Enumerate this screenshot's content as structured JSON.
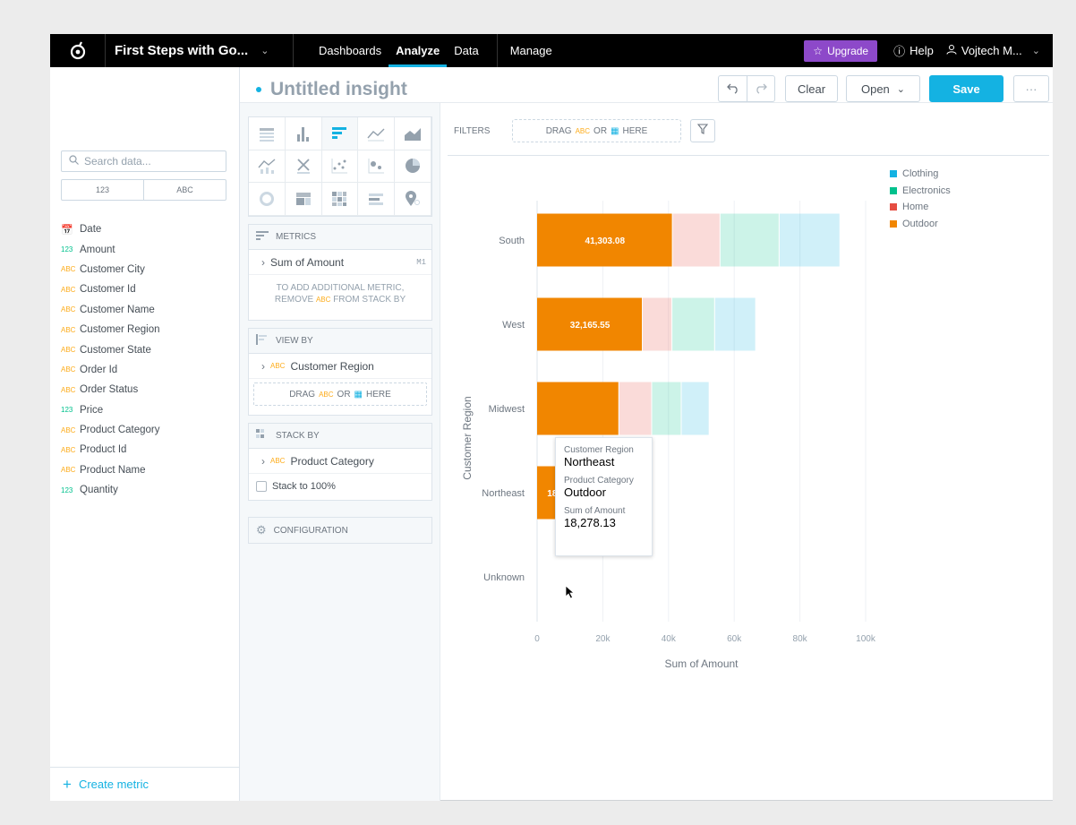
{
  "topbar": {
    "workspace": "First Steps with Go...",
    "nav": [
      {
        "label": "Dashboards"
      },
      {
        "label": "Analyze"
      },
      {
        "label": "Data"
      }
    ],
    "manage": "Manage",
    "upgrade": "Upgrade",
    "help": "Help",
    "user": "Vojtech M..."
  },
  "datapanel": {
    "search_placeholder": "Search data...",
    "type_filters": [
      "123",
      "ABC"
    ],
    "fields": [
      {
        "type": "date",
        "type_label": "📅",
        "name": "Date"
      },
      {
        "type": "num",
        "type_label": "123",
        "name": "Amount"
      },
      {
        "type": "attr",
        "type_label": "ABC",
        "name": "Customer City"
      },
      {
        "type": "attr",
        "type_label": "ABC",
        "name": "Customer Id"
      },
      {
        "type": "attr",
        "type_label": "ABC",
        "name": "Customer Name"
      },
      {
        "type": "attr",
        "type_label": "ABC",
        "name": "Customer Region"
      },
      {
        "type": "attr",
        "type_label": "ABC",
        "name": "Customer State"
      },
      {
        "type": "attr",
        "type_label": "ABC",
        "name": "Order Id"
      },
      {
        "type": "attr",
        "type_label": "ABC",
        "name": "Order Status"
      },
      {
        "type": "num",
        "type_label": "123",
        "name": "Price"
      },
      {
        "type": "attr",
        "type_label": "ABC",
        "name": "Product Category"
      },
      {
        "type": "attr",
        "type_label": "ABC",
        "name": "Product Id"
      },
      {
        "type": "attr",
        "type_label": "ABC",
        "name": "Product Name"
      },
      {
        "type": "num",
        "type_label": "123",
        "name": "Quantity"
      }
    ],
    "create_metric": "Create metric"
  },
  "header": {
    "title": "Untitled insight",
    "clear": "Clear",
    "open": "Open",
    "save": "Save",
    "more": "···"
  },
  "buckets": {
    "metrics": {
      "title": "METRICS",
      "item": "Sum of Amount",
      "item_tag": "M1",
      "note_1": "TO ADD ADDITIONAL METRIC,",
      "note_2a": "REMOVE",
      "note_2b": "ABC",
      "note_2c": "FROM STACK BY"
    },
    "view_by": {
      "title": "VIEW BY",
      "item": "Customer Region"
    },
    "stack_by": {
      "title": "STACK BY",
      "item": "Product Category",
      "stack_100": "Stack to 100%"
    },
    "configuration": "CONFIGURATION",
    "drag_a": "DRAG",
    "drag_abc": "ABC",
    "drag_or": "OR",
    "drag_here": "HERE"
  },
  "filters": {
    "label": "FILTERS"
  },
  "tooltip": {
    "label1": "Customer Region",
    "value1": "Northeast",
    "label2": "Product Category",
    "value2": "Outdoor",
    "label3": "Sum of Amount",
    "value3": "18,278.13"
  },
  "colors": {
    "Clothing": "#14b2e2",
    "Electronics": "#00c18d",
    "Home": "#e54d42",
    "Outdoor": "#f18600"
  },
  "chart_data": {
    "type": "bar",
    "orientation": "horizontal",
    "stacked": true,
    "categories": [
      "South",
      "West",
      "Midwest",
      "Northeast",
      "Unknown"
    ],
    "series": [
      {
        "name": "Outdoor",
        "values": [
          41303.08,
          32165.55,
          25000,
          18278.13,
          0
        ]
      },
      {
        "name": "Home",
        "values": [
          14500,
          9000,
          10000,
          2500,
          0
        ]
      },
      {
        "name": "Electronics",
        "values": [
          18000,
          13000,
          9000,
          5000,
          0
        ]
      },
      {
        "name": "Clothing",
        "values": [
          18500,
          12500,
          8500,
          5700,
          0
        ]
      }
    ],
    "data_labels": [
      "41,303.08",
      "32,165.55",
      "",
      "18,278.13",
      ""
    ],
    "xlabel": "Sum of Amount",
    "ylabel": "Customer Region",
    "xlim": [
      0,
      100000
    ],
    "xticks": [
      "0",
      "20k",
      "40k",
      "60k",
      "80k",
      "100k"
    ],
    "highlighted": {
      "category": "Northeast",
      "series": "Outdoor"
    },
    "legend_position": "top-right",
    "legend": [
      "Clothing",
      "Electronics",
      "Home",
      "Outdoor"
    ]
  }
}
